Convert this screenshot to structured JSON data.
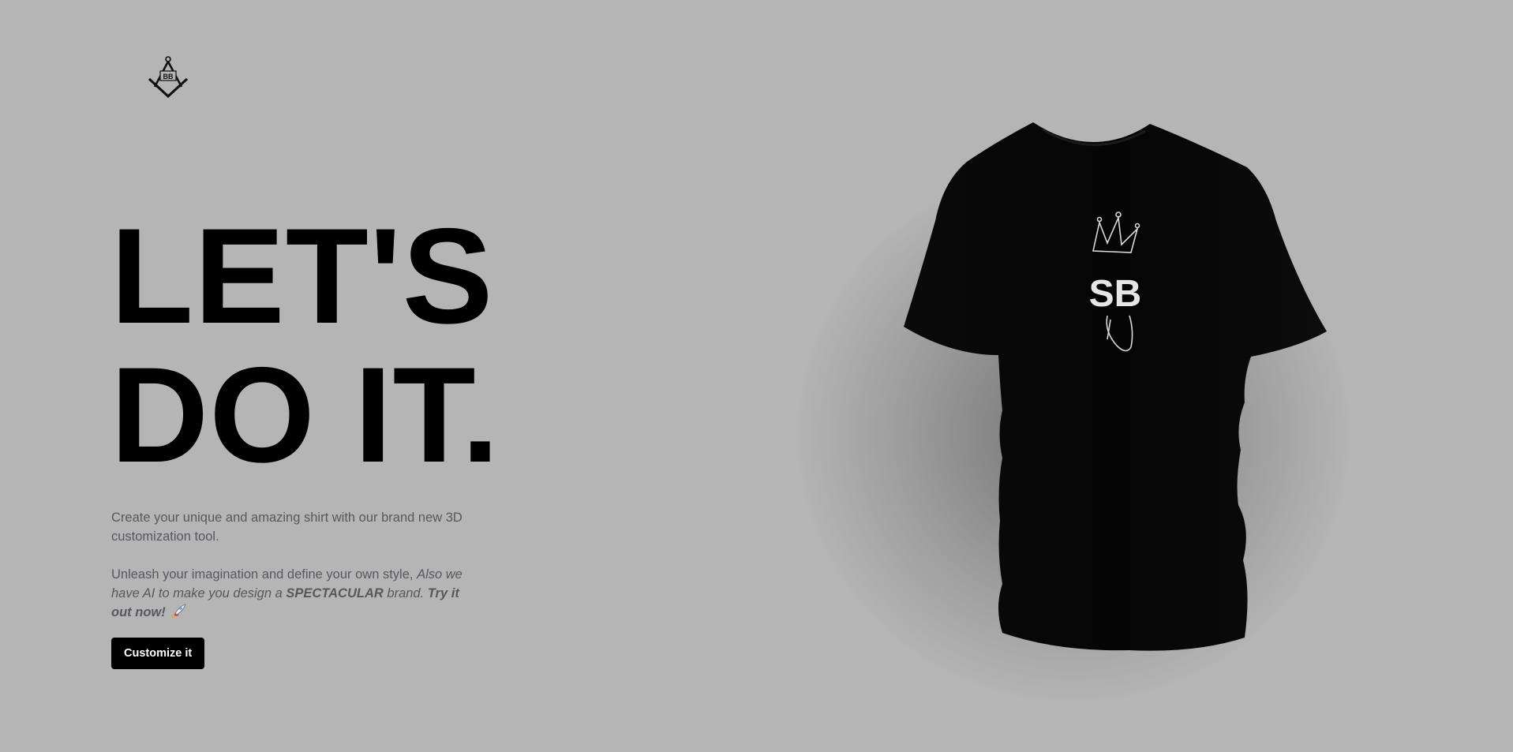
{
  "brand": {
    "logo_icon": "compass-square-icon",
    "logo_text": "BB"
  },
  "hero": {
    "headline_line1": "LET'S",
    "headline_line2": "DO IT.",
    "paragraph1": "Create your unique and amazing shirt with our brand new 3D customization tool.",
    "paragraph2_plain": "Unleash your imagination and define your own style, ",
    "paragraph2_italic_a": "Also we have AI to make you design a ",
    "paragraph2_strong": "SPECTACULAR",
    "paragraph2_italic_b": " brand.",
    "paragraph2_tail": "Try it out now!",
    "rocket_icon": "rocket-icon",
    "cta_label": "Customize it"
  },
  "preview": {
    "shirt_color": "#000000",
    "print_text": "SB",
    "print_icon": "crown-icon"
  },
  "colors": {
    "background": "#b5b5b5",
    "text_muted": "#55585f",
    "button_bg": "#000000",
    "button_text": "#ffffff"
  }
}
